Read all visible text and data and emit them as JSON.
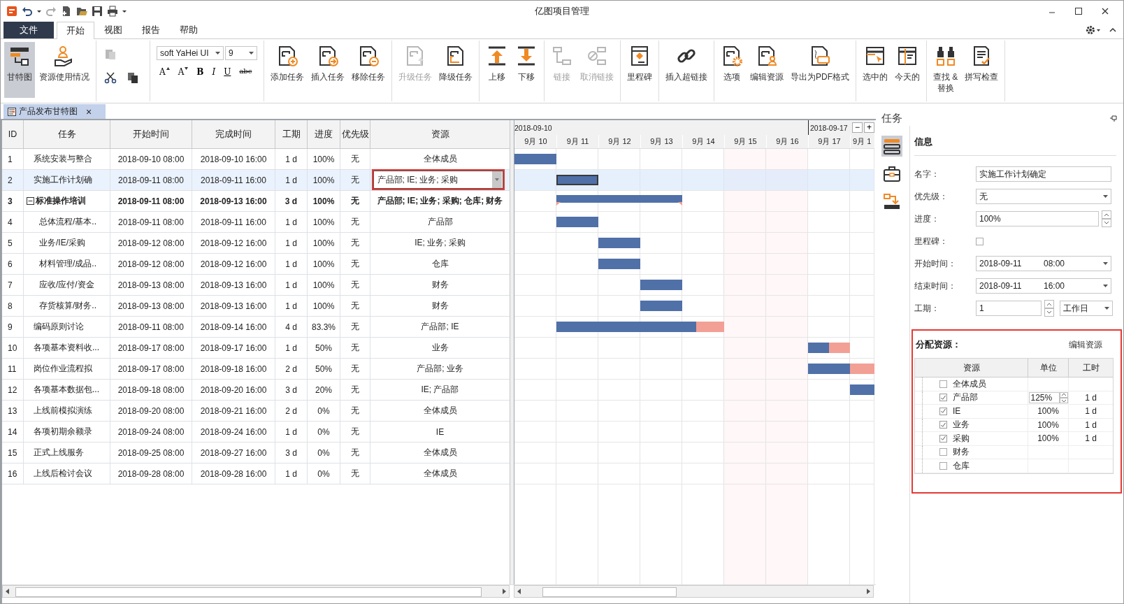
{
  "window": {
    "title": "亿图项目管理"
  },
  "menu": {
    "tabs": [
      {
        "label": "文件",
        "kind": "file",
        "selected": false
      },
      {
        "label": "开始",
        "kind": "tab",
        "selected": true
      },
      {
        "label": "视图",
        "kind": "tab",
        "selected": false
      },
      {
        "label": "报告",
        "kind": "tab",
        "selected": false
      },
      {
        "label": "帮助",
        "kind": "tab",
        "selected": false
      }
    ]
  },
  "ribbon": {
    "groups": [
      {
        "kind": "large",
        "buttons": [
          {
            "label": "甘特图",
            "selected": true,
            "disabled": false
          },
          {
            "label": "资源使用情况",
            "selected": false,
            "disabled": false
          }
        ]
      },
      {
        "kind": "clipboard",
        "buttons": [
          {
            "disabled": true
          },
          {
            "disabled": false
          },
          {
            "disabled": false
          }
        ]
      },
      {
        "kind": "font",
        "font": "soft YaHei UI",
        "size": "9",
        "format_buttons": [
          "A",
          "A",
          "B",
          "I",
          "U",
          "abc"
        ]
      },
      {
        "kind": "large",
        "buttons": [
          {
            "label": "添加任务",
            "selected": false,
            "disabled": false
          },
          {
            "label": "插入任务",
            "selected": false,
            "disabled": false
          },
          {
            "label": "移除任务",
            "selected": false,
            "disabled": false
          }
        ]
      },
      {
        "kind": "large",
        "buttons": [
          {
            "label": "升级任务",
            "selected": false,
            "disabled": true
          },
          {
            "label": "降级任务",
            "selected": false,
            "disabled": false
          }
        ]
      },
      {
        "kind": "large",
        "buttons": [
          {
            "label": "上移",
            "selected": false,
            "disabled": false
          },
          {
            "label": "下移",
            "selected": false,
            "disabled": false
          }
        ]
      },
      {
        "kind": "large",
        "buttons": [
          {
            "label": "链接",
            "selected": false,
            "disabled": true
          },
          {
            "label": "取消链接",
            "selected": false,
            "disabled": true
          }
        ]
      },
      {
        "kind": "large",
        "buttons": [
          {
            "label": "里程碑",
            "selected": false,
            "disabled": false
          }
        ]
      },
      {
        "kind": "large",
        "buttons": [
          {
            "label": "插入超链接",
            "selected": false,
            "disabled": false
          }
        ]
      },
      {
        "kind": "large",
        "buttons": [
          {
            "label": "选项",
            "selected": false,
            "disabled": false
          },
          {
            "label": "编辑资源",
            "selected": false,
            "disabled": false
          },
          {
            "label": "导出为PDF格式",
            "selected": false,
            "disabled": false
          }
        ]
      },
      {
        "kind": "large",
        "buttons": [
          {
            "label": "选中的",
            "selected": false,
            "disabled": false
          },
          {
            "label": "今天的",
            "selected": false,
            "disabled": false
          }
        ]
      },
      {
        "kind": "large",
        "buttons": [
          {
            "label": "查找 &\n替换",
            "selected": false,
            "disabled": false
          },
          {
            "label": "拼写检查",
            "selected": false,
            "disabled": false
          }
        ]
      }
    ]
  },
  "document_tab": {
    "label": "产品发布甘特图",
    "close": "×"
  },
  "table": {
    "columns": [
      "ID",
      "任务",
      "开始时间",
      "完成时间",
      "工期",
      "进度",
      "优先级",
      "资源"
    ],
    "rows": [
      {
        "id": "1",
        "task": "系统安装与整合",
        "start": "2018-09-10 08:00",
        "end": "2018-09-10 16:00",
        "duration": "1 d",
        "progress": "100%",
        "priority": "无",
        "resource": "全体成员",
        "selected": false
      },
      {
        "id": "2",
        "task": "实施工作计划确",
        "start": "2018-09-11 08:00",
        "end": "2018-09-11 16:00",
        "duration": "1 d",
        "progress": "100%",
        "priority": "无",
        "resource": "产品部; IE; 业务; 采购",
        "selected": true,
        "editing": true
      },
      {
        "id": "3",
        "task": "标准操作培训",
        "start": "2018-09-11 08:00",
        "end": "2018-09-13 16:00",
        "duration": "3 d",
        "progress": "100%",
        "priority": "无",
        "resource": "产品部; IE; 业务; 采购; 仓库; 财务",
        "selected": false,
        "expanded": true,
        "children": [
          {
            "id": "4",
            "task": "总体流程/基本..",
            "start": "2018-09-11 08:00",
            "end": "2018-09-11 16:00",
            "duration": "1 d",
            "progress": "100%",
            "priority": "无",
            "resource": "产品部",
            "selected": false
          },
          {
            "id": "5",
            "task": "业务/IE/采购",
            "start": "2018-09-12 08:00",
            "end": "2018-09-12 16:00",
            "duration": "1 d",
            "progress": "100%",
            "priority": "无",
            "resource": "IE; 业务; 采购",
            "selected": false
          },
          {
            "id": "6",
            "task": "材料管理/成品..",
            "start": "2018-09-12 08:00",
            "end": "2018-09-12 16:00",
            "duration": "1 d",
            "progress": "100%",
            "priority": "无",
            "resource": "仓库",
            "selected": false
          },
          {
            "id": "7",
            "task": "应收/应付/资金",
            "start": "2018-09-13 08:00",
            "end": "2018-09-13 16:00",
            "duration": "1 d",
            "progress": "100%",
            "priority": "无",
            "resource": "财务",
            "selected": false
          },
          {
            "id": "8",
            "task": "存货核算/财务..",
            "start": "2018-09-13 08:00",
            "end": "2018-09-13 16:00",
            "duration": "1 d",
            "progress": "100%",
            "priority": "无",
            "resource": "财务",
            "selected": false
          }
        ]
      },
      {
        "id": "9",
        "task": "编码原则讨论",
        "start": "2018-09-11 08:00",
        "end": "2018-09-14 16:00",
        "duration": "4 d",
        "progress": "83.3%",
        "priority": "无",
        "resource": "产品部; IE",
        "selected": false
      },
      {
        "id": "10",
        "task": "各项基本资料收...",
        "start": "2018-09-17 08:00",
        "end": "2018-09-17 16:00",
        "duration": "1 d",
        "progress": "50%",
        "priority": "无",
        "resource": "业务",
        "selected": false
      },
      {
        "id": "11",
        "task": "岗位作业流程拟",
        "start": "2018-09-17 08:00",
        "end": "2018-09-18 16:00",
        "duration": "2 d",
        "progress": "50%",
        "priority": "无",
        "resource": "产品部; 业务",
        "selected": false
      },
      {
        "id": "12",
        "task": "各项基本数据包...",
        "start": "2018-09-18 08:00",
        "end": "2018-09-20 16:00",
        "duration": "3 d",
        "progress": "20%",
        "priority": "无",
        "resource": "IE; 产品部",
        "selected": false
      },
      {
        "id": "13",
        "task": "上线前模拟演练",
        "start": "2018-09-20 08:00",
        "end": "2018-09-21 16:00",
        "duration": "2 d",
        "progress": "0%",
        "priority": "无",
        "resource": "全体成员",
        "selected": false
      },
      {
        "id": "14",
        "task": "各项初期余额录",
        "start": "2018-09-24 08:00",
        "end": "2018-09-24 16:00",
        "duration": "1 d",
        "progress": "0%",
        "priority": "无",
        "resource": "IE",
        "selected": false
      },
      {
        "id": "15",
        "task": "正式上线服务",
        "start": "2018-09-25 08:00",
        "end": "2018-09-27 16:00",
        "duration": "3 d",
        "progress": "0%",
        "priority": "无",
        "resource": "全体成员",
        "selected": false
      },
      {
        "id": "16",
        "task": "上线后检讨会议",
        "start": "2018-09-28 08:00",
        "end": "2018-09-28 16:00",
        "duration": "1 d",
        "progress": "0%",
        "priority": "无",
        "resource": "全体成员",
        "selected": false
      }
    ]
  },
  "gantt": {
    "weeks": [
      {
        "label": "2018-09-10"
      },
      {
        "label": "2018-09-17"
      }
    ],
    "zoom_buttons": [
      "−",
      "+"
    ],
    "days": [
      {
        "label": "9月 10",
        "weekend": false
      },
      {
        "label": "9月 11",
        "weekend": false
      },
      {
        "label": "9月 12",
        "weekend": false
      },
      {
        "label": "9月 13",
        "weekend": false
      },
      {
        "label": "9月 14",
        "weekend": false
      },
      {
        "label": "9月 15",
        "weekend": true
      },
      {
        "label": "9月 16",
        "weekend": true
      },
      {
        "label": "9月 17",
        "weekend": false
      },
      {
        "label": "9月 1",
        "weekend": false
      }
    ]
  },
  "panel": {
    "title": "任务",
    "side_icons": [
      {
        "selected": true
      },
      {
        "selected": false
      },
      {
        "selected": false
      }
    ],
    "info": {
      "heading": "信息",
      "fields": [
        {
          "kind": "text",
          "label": "名字：",
          "value": "实施工作计划确定"
        },
        {
          "kind": "select",
          "label": "优先级：",
          "value": "无"
        },
        {
          "kind": "spin",
          "label": "进度：",
          "value": "100%"
        },
        {
          "kind": "checkbox",
          "label": "里程碑：",
          "checked": false
        },
        {
          "kind": "datetime",
          "label": "开始时间：",
          "value": "2018-09-11",
          "time": "08:00"
        },
        {
          "kind": "datetime",
          "label": "结束时间：",
          "value": "2018-09-11",
          "time": "16:00"
        },
        {
          "kind": "duration",
          "label": "工期：",
          "value": "1",
          "unit": "工作日"
        }
      ]
    },
    "assign": {
      "title": "分配资源：",
      "link": "编辑资源",
      "highlighted": true,
      "columns": [
        "资源",
        "单位",
        "工时"
      ],
      "rows": [
        {
          "name": "全体成员",
          "checked": false
        },
        {
          "name": "产品部",
          "checked": true,
          "unit": "125%",
          "work": "1 d",
          "editing": true
        },
        {
          "name": "IE",
          "checked": true,
          "unit": "100%",
          "work": "1 d"
        },
        {
          "name": "业务",
          "checked": true,
          "unit": "100%",
          "work": "1 d"
        },
        {
          "name": "采购",
          "checked": true,
          "unit": "100%",
          "work": "1 d"
        },
        {
          "name": "财务",
          "checked": false
        },
        {
          "name": "仓库",
          "checked": false
        }
      ]
    }
  }
}
